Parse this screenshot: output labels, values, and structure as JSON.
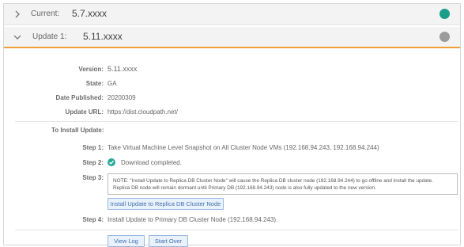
{
  "current": {
    "label": "Current:",
    "value": "5.7.xxxx",
    "status_color": "#1a9e8a",
    "icon": "chevron-right-icon"
  },
  "update": {
    "label": "Update 1:",
    "value": "5.11.xxxx",
    "status_color": "#9b9b9b",
    "icon": "chevron-down-icon"
  },
  "details": {
    "version": {
      "label": "Version:",
      "value": "5.11.xxxx"
    },
    "state": {
      "label": "State:",
      "value": "GA"
    },
    "date_published": {
      "label": "Date Published:",
      "value": "20200309"
    },
    "update_url": {
      "label": "Update URL:",
      "value": "https://dist.cloudpath.net/"
    }
  },
  "install": {
    "title": "To Install Update:",
    "step1": {
      "label": "Step 1:",
      "text": "Take Virtual Machine Level Snapshot on All Cluster Node VMs (192.168.94.243, 192.168.94.244)"
    },
    "step2": {
      "label": "Step 2:",
      "text": "Download completed.",
      "icon": "check-circle-icon"
    },
    "step3": {
      "label": "Step 3:",
      "note_line1": "NOTE: \"Install Update to Replica DB Cluster Node\" will cause the Replica DB cluster node (192.168.94.244) to go offline and install the update.",
      "note_line2": "Replica DB node will remain dormant until Primary DB (192.168.94.243) node is also fully updated to the new version.",
      "button": "Install Update to Replica DB Cluster Node"
    },
    "step4": {
      "label": "Step 4:",
      "text": "Install Update to Primary DB Cluster Node (192.168.94.243)."
    }
  },
  "actions": {
    "view_log": "View Log",
    "start_over": "Start Over"
  }
}
